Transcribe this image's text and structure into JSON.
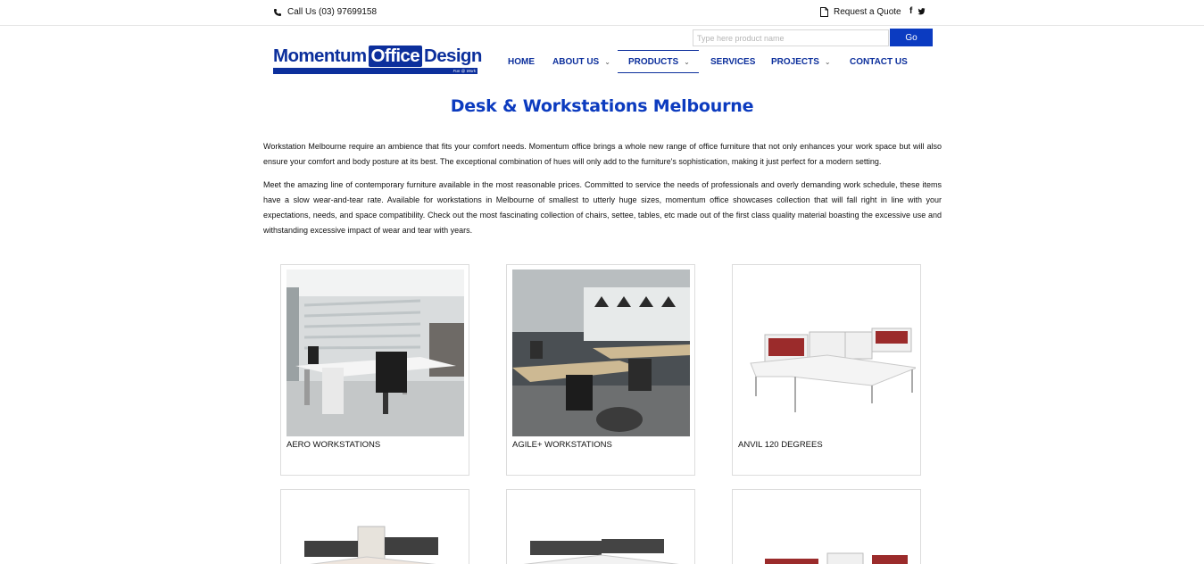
{
  "topbar": {
    "phone_text": "Call Us (03) 97699158",
    "quote_text": "Request a Quote",
    "facebook_icon": "f",
    "twitter_icon": "twitter-bird"
  },
  "search": {
    "placeholder": "Type here product name",
    "go_label": "Go"
  },
  "logo": {
    "part1": "Momentum",
    "part2": "Office",
    "part3": "Design",
    "tagline": "Fun @ Work"
  },
  "nav": {
    "items": [
      {
        "label": "HOME",
        "has_dropdown": false
      },
      {
        "label": "ABOUT US",
        "has_dropdown": true
      },
      {
        "label": "PRODUCTS",
        "has_dropdown": true,
        "active": true
      },
      {
        "label": "SERVICES",
        "has_dropdown": false
      },
      {
        "label": "PROJECTS",
        "has_dropdown": true
      },
      {
        "label": "CONTACT US",
        "has_dropdown": false
      }
    ],
    "chevron": "⌄"
  },
  "page": {
    "title": "Desk & Workstations Melbourne",
    "paragraphs": [
      "Workstation Melbourne require an ambience that fits your comfort needs. Momentum office brings a whole new range of office furniture that not only enhances your work space but will also ensure your comfort and body posture at its best. The exceptional combination of hues will only add to the furniture's sophistication, making it just perfect for a modern setting.",
      "Meet the amazing line of contemporary furniture available in the most reasonable prices. Committed to service the needs of professionals and overly demanding work schedule, these items have a slow wear-and-tear rate. Available for workstations in Melbourne of smallest to utterly huge sizes, momentum office showcases collection that will fall right in line with your expectations, needs, and space compatibility. Check out the most fascinating collection of chairs, settee, tables, etc made out of the first class quality material boasting the excessive use and withstanding excessive impact of wear and tear with years."
    ]
  },
  "products": [
    {
      "label": "AERO WORKSTATIONS"
    },
    {
      "label": "AGILE+ WORKSTATIONS"
    },
    {
      "label": "ANVIL 120 DEGREES"
    },
    {
      "label": ""
    },
    {
      "label": ""
    },
    {
      "label": ""
    }
  ],
  "colors": {
    "brand_blue": "#0c2f9c",
    "title_blue": "#0c3bbf",
    "button_blue": "#0b3bc1",
    "screen_red": "#9b2b2b"
  }
}
